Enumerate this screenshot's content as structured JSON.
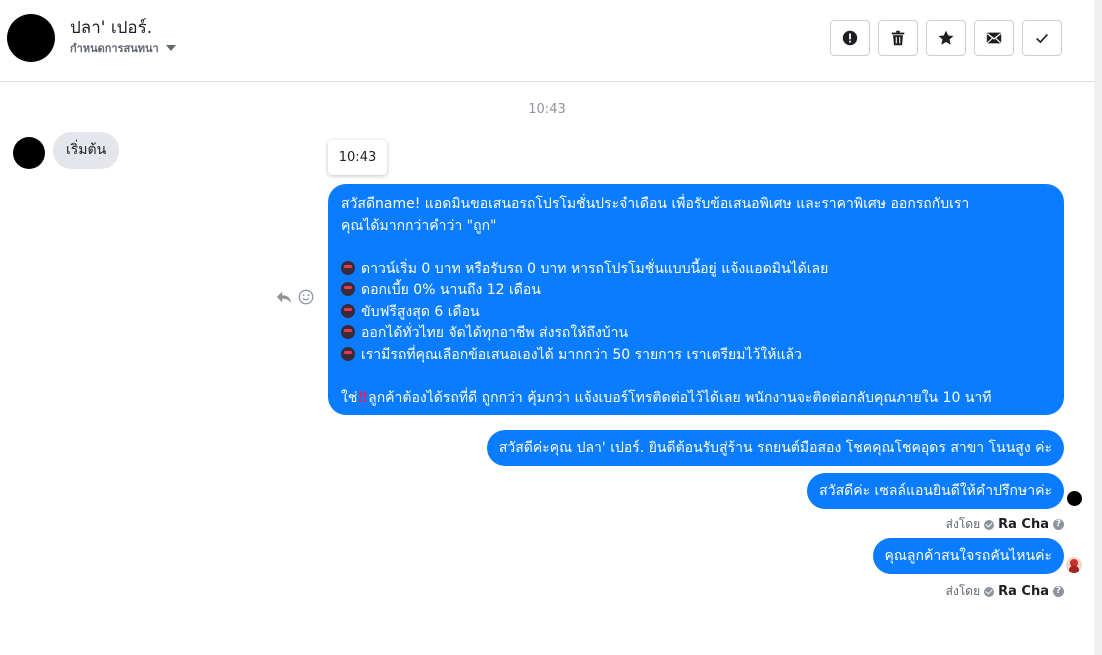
{
  "header": {
    "contact_name": "ปลา' เปอร์.",
    "stage_label": "กำหนดการสนทนา",
    "icons": [
      "report-icon",
      "trash-icon",
      "star-icon",
      "envelope-icon",
      "check-icon"
    ]
  },
  "conversation": {
    "time_separator": "10:43",
    "incoming_message": "เริ่มต้น",
    "hover_time": "10:43",
    "promo_message": {
      "lines": [
        "สวัสดีname! แอดมินขอเสนอรถโปรโมชั่นประจำเดือน เพื่อรับข้อเสนอพิเศษ และราคาพิเศษ ออกรถกับเรา",
        "คุณได้มากกว่าคำว่า \"ถูก\""
      ],
      "bullets": [
        "ดาวน์เริ่ม 0 บาท หรือรับรถ 0 บาท หารถโปรโมชั่นแบบนี้อยู่ แจ้งแอดมินได้เลย",
        "ดอกเบี้ย 0% นานถึง 12 เดือน",
        "ขับฟรีสูงสุด 6 เดือน",
        "ออกได้ทั่วไทย จัดได้ทุกอาชีพ ส่งรถให้ถึงบ้าน",
        "เรามีรถที่คุณเลือกข้อเสนอเองได้ มากกว่า 50 รายการ เราเตรียมไว้ให้แล้ว"
      ],
      "footer_prefix": "ใช่",
      "footer_emoji": "‼",
      "footer_text": "ลูกค้าต้องได้รถที่ดี ถูกกว่า คุ้มกว่า แจ้งเบอร์โทรติดต่อไว้ได้เลย พนักงานจะติดต่อกลับคุณภายใน 10 นาที"
    },
    "greeting_message": "สวัสดีค่ะคุณ ปลา' เปอร์. ยินดีต้อนรับสู่ร้าน รถยนต์มือสอง โชคคุณโชคอุดร สาขา โนนสูง ค่ะ",
    "welcome_message": "สวัสดีค่ะ เซลล์แอนยินดีให้คำปรึกษาค่ะ",
    "question_message": "คุณลูกค้าสนใจรถคันไหนค่ะ",
    "sent_by_label": "ส่งโดย",
    "sender_name": "Ra Cha",
    "help_glyph": "?"
  },
  "colors": {
    "outgoing_bubble": "#0a7cff",
    "incoming_bubble": "#e4e6eb",
    "border": "#ccd0d5",
    "muted_text": "#8d949e"
  }
}
